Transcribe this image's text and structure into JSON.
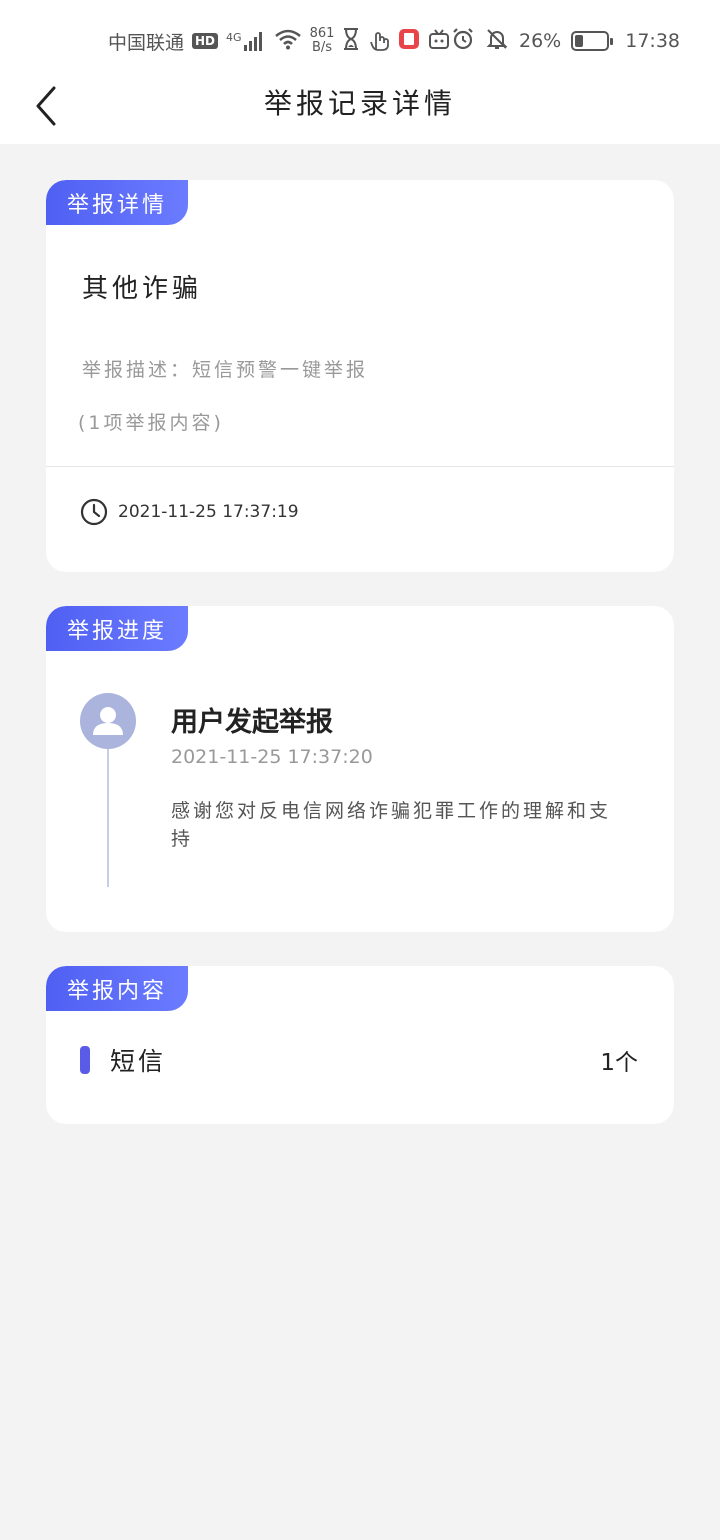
{
  "status_bar": {
    "carrier": "中国联通",
    "hd_badge": "HD",
    "network": "4G",
    "speed_value": "861",
    "speed_unit": "B/s",
    "battery_percent": "26%",
    "battery_level": 0.26,
    "time": "17:38"
  },
  "nav": {
    "title": "举报记录详情"
  },
  "detail_card": {
    "tag": "举报详情",
    "category": "其他诈骗",
    "desc_label": "举报描述：",
    "desc_value": "短信预警一键举报",
    "count_text": "(1项举报内容)",
    "time": "2021-11-25 17:37:19"
  },
  "progress_card": {
    "tag": "举报进度",
    "steps": [
      {
        "title": "用户发起举报",
        "time": "2021-11-25 17:37:20",
        "message": "感谢您对反电信网络诈骗犯罪工作的理解和支持"
      }
    ]
  },
  "content_card": {
    "tag": "举报内容",
    "items": [
      {
        "label": "短信",
        "count": "1个"
      }
    ]
  },
  "colors": {
    "accent": "#5a5ce8",
    "tag_gradient_start": "#4f5ff2",
    "tag_gradient_end": "#6c7cff",
    "background": "#f3f3f3"
  }
}
